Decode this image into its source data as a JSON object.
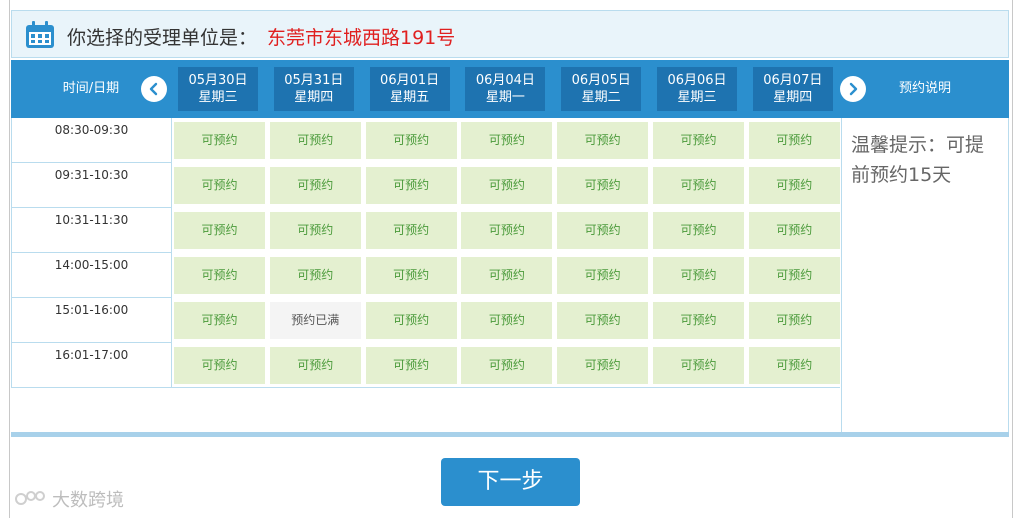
{
  "header": {
    "label": "你选择的受理单位是：",
    "unit": "东莞市东城西路191号"
  },
  "nav": {
    "time_label": "时间/日期",
    "desc_label": "预约说明",
    "days": [
      {
        "date": "05月30日",
        "weekday": "星期三"
      },
      {
        "date": "05月31日",
        "weekday": "星期四"
      },
      {
        "date": "06月01日",
        "weekday": "星期五"
      },
      {
        "date": "06月04日",
        "weekday": "星期一"
      },
      {
        "date": "06月05日",
        "weekday": "星期二"
      },
      {
        "date": "06月06日",
        "weekday": "星期三"
      },
      {
        "date": "06月07日",
        "weekday": "星期四"
      }
    ]
  },
  "chart_data": {
    "type": "table",
    "columns": [
      "05月30日 星期三",
      "05月31日 星期四",
      "06月01日 星期五",
      "06月04日 星期一",
      "06月05日 星期二",
      "06月06日 星期三",
      "06月07日 星期四"
    ],
    "rows": [
      {
        "time": "08:30-09:30",
        "cells": [
          "可预约",
          "可预约",
          "可预约",
          "可预约",
          "可预约",
          "可预约",
          "可预约"
        ]
      },
      {
        "time": "09:31-10:30",
        "cells": [
          "可预约",
          "可预约",
          "可预约",
          "可预约",
          "可预约",
          "可预约",
          "可预约"
        ]
      },
      {
        "time": "10:31-11:30",
        "cells": [
          "可预约",
          "可预约",
          "可预约",
          "可预约",
          "可预约",
          "可预约",
          "可预约"
        ]
      },
      {
        "time": "14:00-15:00",
        "cells": [
          "可预约",
          "可预约",
          "可预约",
          "可预约",
          "可预约",
          "可预约",
          "可预约"
        ]
      },
      {
        "time": "15:01-16:00",
        "cells": [
          "可预约",
          "预约已满",
          "可预约",
          "可预约",
          "可预约",
          "可预约",
          "可预约"
        ]
      },
      {
        "time": "16:01-17:00",
        "cells": [
          "可预约",
          "可预约",
          "可预约",
          "可预约",
          "可预约",
          "可预约",
          "可预约"
        ]
      }
    ]
  },
  "tips": {
    "text": "温馨提示：可提前预约15天"
  },
  "actions": {
    "next_label": "下一步"
  },
  "watermark": {
    "text": "大数跨境"
  },
  "colors": {
    "primary": "#2b8fce",
    "day_header": "#1e73b0",
    "available_bg": "#e4f0d0",
    "available_text": "#4a9a3a",
    "full_bg": "#f4f4f4",
    "accent_red": "#e02020"
  }
}
